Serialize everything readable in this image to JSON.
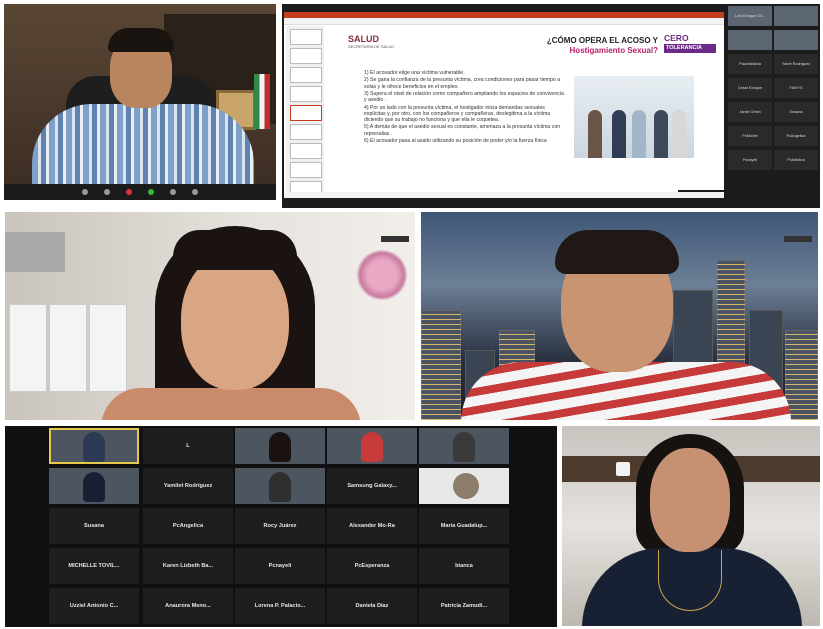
{
  "slide": {
    "logo_title": "SALUD",
    "logo_subtitle": "SECRETARÍA DE SALUD",
    "title_line1": "¿CÓMO OPERA EL ACOSO Y",
    "title_line2": "Hostigamiento Sexual?",
    "badge_line1": "CERO",
    "badge_line2": "TOLERANCIA",
    "items": [
      "1) El acosador elige una víctima vulnerable.",
      "2) Se gana la confianza de la presunta víctima, crea condiciones para pasar tiempo a solas y le ofrece beneficios en el empleo.",
      "3) Supera el nivel de relación como compañero ampliando los espacios de convivencia y asedio .",
      "4) Por un lado con la presunta víctima, el hostigador inicia demandas sexuales explícitas y, por otro, con los compañeros y compañeras, deslegitima a la víctima diciendo que su trabajo no funciona y que ella le coquetea.",
      "5) A demás de que el asedio sexual es constante, amenaza a la presunta víctima con represalias .",
      "6) El acosador pasa al asalto utilizando su posición de poder y/o la fuerza física"
    ]
  },
  "side_gallery": [
    "Luis Enrique Gil...",
    "",
    "",
    "",
    "PacoValdivia",
    "Yanet Rodríguez",
    "César Enrique",
    "FAVIYS",
    "Jamie Orlein",
    "Susana",
    "PcMichel",
    "PcAngelica",
    "Pcnayeli",
    "PcAdriana"
  ],
  "gallery": {
    "tiles": [
      {
        "name": "",
        "video": true
      },
      {
        "name": "L",
        "video": false
      },
      {
        "name": "",
        "video": true
      },
      {
        "name": "",
        "video": true
      },
      {
        "name": "",
        "video": true
      },
      {
        "name": "",
        "video": true
      },
      {
        "name": "Yamilet Rodriguez",
        "video": false
      },
      {
        "name": "",
        "video": true
      },
      {
        "name": "Samsung Galaxy...",
        "video": false
      },
      {
        "name": "",
        "video": true
      },
      {
        "name": "Susana",
        "video": false
      },
      {
        "name": "PcAngelica",
        "video": false
      },
      {
        "name": "Rocy Juárez",
        "video": false
      },
      {
        "name": "Alexander Mo-Ra",
        "video": false
      },
      {
        "name": "María Guadalup...",
        "video": false
      },
      {
        "name": "MICHELLE TOVIL...",
        "video": false
      },
      {
        "name": "Karen Lizbeth Ba...",
        "video": false
      },
      {
        "name": "Pcnayeli",
        "video": false
      },
      {
        "name": "PcEsperanza",
        "video": false
      },
      {
        "name": "bianca",
        "video": false
      },
      {
        "name": "Uzziel Antonio C...",
        "video": false
      },
      {
        "name": "Anaurora Meno...",
        "video": false
      },
      {
        "name": "Lorena P. Palacio...",
        "video": false
      },
      {
        "name": "Daniela Díaz",
        "video": false
      },
      {
        "name": "Patricia Zamudi...",
        "video": false
      }
    ]
  }
}
